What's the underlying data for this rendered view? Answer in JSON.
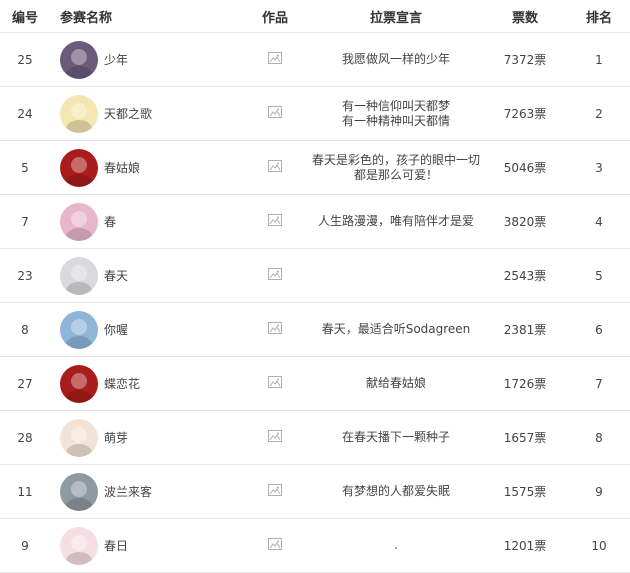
{
  "headers": {
    "id": "编号",
    "name": "参赛名称",
    "work": "作品",
    "slogan": "拉票宣言",
    "votes": "票数",
    "rank": "排名"
  },
  "rows": [
    {
      "id": "25",
      "name": "少年",
      "slogan": "我愿做风一样的少年",
      "votes": "7372票",
      "rank": "1",
      "avatar_color": "#6b5a7a"
    },
    {
      "id": "24",
      "name": "天都之歌",
      "slogan": "有一种信仰叫天都梦\n有一种精神叫天都情",
      "votes": "7263票",
      "rank": "2",
      "avatar_color": "#f4e6b0"
    },
    {
      "id": "5",
      "name": "春姑娘",
      "slogan": "春天是彩色的，孩子的眼中一切都是那么可爱！",
      "votes": "5046票",
      "rank": "3",
      "avatar_color": "#a81c1c"
    },
    {
      "id": "7",
      "name": "春",
      "slogan": "人生路漫漫，唯有陪伴才是爱",
      "votes": "3820票",
      "rank": "4",
      "avatar_color": "#e7b7c9"
    },
    {
      "id": "23",
      "name": "春天",
      "slogan": "",
      "votes": "2543票",
      "rank": "5",
      "avatar_color": "#d9d9de"
    },
    {
      "id": "8",
      "name": "你喔",
      "slogan": "春天，最适合听Sodagreen",
      "votes": "2381票",
      "rank": "6",
      "avatar_color": "#8fb6d9"
    },
    {
      "id": "27",
      "name": "蝶恋花",
      "slogan": "献给春姑娘",
      "votes": "1726票",
      "rank": "7",
      "avatar_color": "#a81c1c"
    },
    {
      "id": "28",
      "name": "萌芽",
      "slogan": "在春天播下一颗种子",
      "votes": "1657票",
      "rank": "8",
      "avatar_color": "#f3e3d6"
    },
    {
      "id": "11",
      "name": "波兰来客",
      "slogan": "有梦想的人都爱失眠",
      "votes": "1575票",
      "rank": "9",
      "avatar_color": "#8c9aa2"
    },
    {
      "id": "9",
      "name": "春日",
      "slogan": ".",
      "votes": "1201票",
      "rank": "10",
      "avatar_color": "#f5dfe4"
    }
  ],
  "icons": {
    "work": "image-placeholder-icon"
  }
}
